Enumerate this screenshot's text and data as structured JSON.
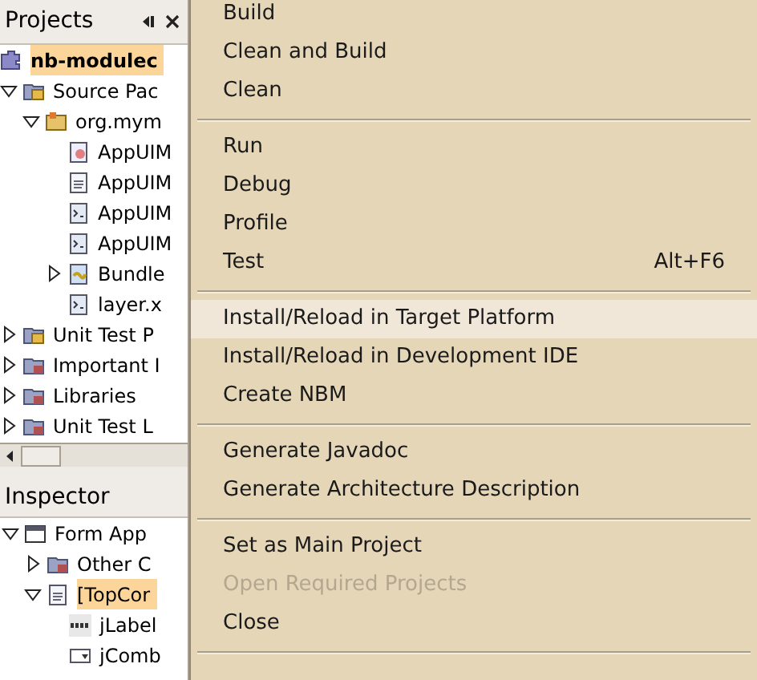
{
  "projects_panel": {
    "title": "Projects",
    "tree": [
      {
        "label": "nb-modulec",
        "kind": "module",
        "selected": true,
        "children": [
          {
            "label": "Source Pac",
            "kind": "package-folder",
            "expanded": true,
            "selected": false,
            "children": [
              {
                "label": "org.mym",
                "kind": "package",
                "expanded": true,
                "selected": false,
                "children": [
                  {
                    "label": "AppUIM",
                    "kind": "form",
                    "selected": false
                  },
                  {
                    "label": "AppUIM",
                    "kind": "doc",
                    "selected": false
                  },
                  {
                    "label": "AppUIM",
                    "kind": "xml",
                    "selected": false
                  },
                  {
                    "label": "AppUIM",
                    "kind": "xml",
                    "selected": false
                  },
                  {
                    "label": "Bundle",
                    "kind": "props",
                    "expanded": false,
                    "selected": false
                  },
                  {
                    "label": "layer.x",
                    "kind": "xml",
                    "selected": false
                  }
                ]
              }
            ]
          },
          {
            "label": "Unit Test P",
            "kind": "package-folder",
            "expanded": false,
            "selected": false
          },
          {
            "label": "Important I",
            "kind": "folder",
            "expanded": false,
            "selected": false
          },
          {
            "label": "Libraries",
            "kind": "folder",
            "expanded": false,
            "selected": false
          },
          {
            "label": "Unit Test L",
            "kind": "folder",
            "expanded": false,
            "selected": false
          }
        ]
      }
    ]
  },
  "inspector_panel": {
    "title": "Inspector",
    "tree": [
      {
        "label": "Form App",
        "kind": "window",
        "expanded": true,
        "selected": false,
        "children": [
          {
            "label": "Other C",
            "kind": "folder",
            "expanded": false,
            "selected": false
          },
          {
            "label": "[TopCor",
            "kind": "doc",
            "expanded": true,
            "selected": true,
            "children": [
              {
                "label": "jLabel",
                "kind": "label",
                "selected": false
              },
              {
                "label": "jComb",
                "kind": "combo",
                "selected": false
              }
            ]
          }
        ]
      }
    ]
  },
  "context_menu": [
    {
      "kind": "item",
      "label": "Build",
      "disabled": false,
      "selected": false
    },
    {
      "kind": "item",
      "label": "Clean and Build",
      "disabled": false,
      "selected": false
    },
    {
      "kind": "item",
      "label": "Clean",
      "disabled": false,
      "selected": false
    },
    {
      "kind": "separator"
    },
    {
      "kind": "item",
      "label": "Run",
      "disabled": false,
      "selected": false
    },
    {
      "kind": "item",
      "label": "Debug",
      "disabled": false,
      "selected": false
    },
    {
      "kind": "item",
      "label": "Profile",
      "disabled": false,
      "selected": false
    },
    {
      "kind": "item",
      "label": "Test",
      "shortcut": "Alt+F6",
      "disabled": false,
      "selected": false
    },
    {
      "kind": "separator"
    },
    {
      "kind": "item",
      "label": "Install/Reload in Target Platform",
      "disabled": false,
      "selected": true
    },
    {
      "kind": "item",
      "label": "Install/Reload in Development IDE",
      "disabled": false,
      "selected": false
    },
    {
      "kind": "item",
      "label": "Create NBM",
      "disabled": false,
      "selected": false
    },
    {
      "kind": "separator"
    },
    {
      "kind": "item",
      "label": "Generate Javadoc",
      "disabled": false,
      "selected": false
    },
    {
      "kind": "item",
      "label": "Generate Architecture Description",
      "disabled": false,
      "selected": false
    },
    {
      "kind": "separator"
    },
    {
      "kind": "item",
      "label": "Set as Main Project",
      "disabled": false,
      "selected": false
    },
    {
      "kind": "item",
      "label": "Open Required Projects",
      "disabled": true,
      "selected": false
    },
    {
      "kind": "item",
      "label": "Close",
      "disabled": false,
      "selected": false
    },
    {
      "kind": "separator"
    }
  ]
}
